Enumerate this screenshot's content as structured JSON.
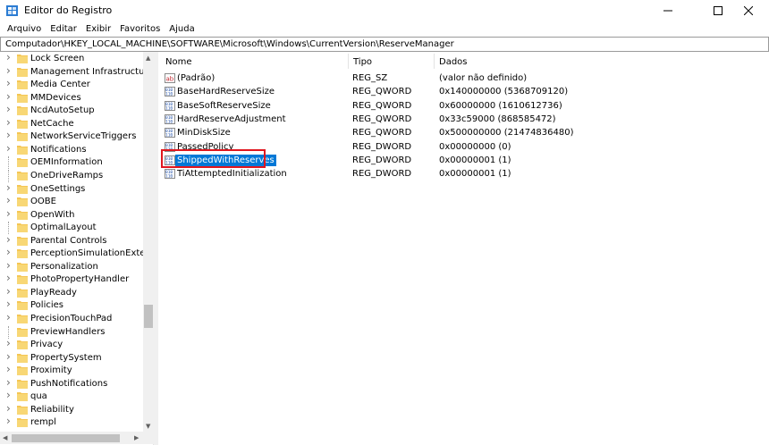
{
  "window": {
    "title": "Editor do Registro"
  },
  "menu": [
    "Arquivo",
    "Editar",
    "Exibir",
    "Favoritos",
    "Ajuda"
  ],
  "address": "Computador\\HKEY_LOCAL_MACHINE\\SOFTWARE\\Microsoft\\Windows\\CurrentVersion\\ReserveManager",
  "tree": [
    {
      "label": "Lock Screen",
      "chevron": true
    },
    {
      "label": "Management Infrastructure",
      "chevron": true
    },
    {
      "label": "Media Center",
      "chevron": true
    },
    {
      "label": "MMDevices",
      "chevron": true
    },
    {
      "label": "NcdAutoSetup",
      "chevron": true
    },
    {
      "label": "NetCache",
      "chevron": true
    },
    {
      "label": "NetworkServiceTriggers",
      "chevron": true
    },
    {
      "label": "Notifications",
      "chevron": true
    },
    {
      "label": "OEMInformation",
      "chevron": false
    },
    {
      "label": "OneDriveRamps",
      "chevron": false
    },
    {
      "label": "OneSettings",
      "chevron": true
    },
    {
      "label": "OOBE",
      "chevron": true
    },
    {
      "label": "OpenWith",
      "chevron": true
    },
    {
      "label": "OptimalLayout",
      "chevron": false
    },
    {
      "label": "Parental Controls",
      "chevron": true
    },
    {
      "label": "PerceptionSimulationExtensic",
      "chevron": true
    },
    {
      "label": "Personalization",
      "chevron": true
    },
    {
      "label": "PhotoPropertyHandler",
      "chevron": true
    },
    {
      "label": "PlayReady",
      "chevron": true
    },
    {
      "label": "Policies",
      "chevron": true
    },
    {
      "label": "PrecisionTouchPad",
      "chevron": true
    },
    {
      "label": "PreviewHandlers",
      "chevron": false
    },
    {
      "label": "Privacy",
      "chevron": true
    },
    {
      "label": "PropertySystem",
      "chevron": true
    },
    {
      "label": "Proximity",
      "chevron": true
    },
    {
      "label": "PushNotifications",
      "chevron": true
    },
    {
      "label": "qua",
      "chevron": true
    },
    {
      "label": "Reliability",
      "chevron": true
    },
    {
      "label": "rempl",
      "chevron": true
    }
  ],
  "columns": {
    "name": "Nome",
    "type": "Tipo",
    "data": "Dados"
  },
  "values": [
    {
      "name": "(Padrão)",
      "type": "REG_SZ",
      "data": "(valor não definido)",
      "icon": "string-value-icon"
    },
    {
      "name": "BaseHardReserveSize",
      "type": "REG_QWORD",
      "data": "0x140000000 (5368709120)",
      "icon": "binary-value-icon"
    },
    {
      "name": "BaseSoftReserveSize",
      "type": "REG_QWORD",
      "data": "0x60000000 (1610612736)",
      "icon": "binary-value-icon"
    },
    {
      "name": "HardReserveAdjustment",
      "type": "REG_QWORD",
      "data": "0x33c59000 (868585472)",
      "icon": "binary-value-icon"
    },
    {
      "name": "MinDiskSize",
      "type": "REG_QWORD",
      "data": "0x500000000 (21474836480)",
      "icon": "binary-value-icon"
    },
    {
      "name": "PassedPolicy",
      "type": "REG_DWORD",
      "data": "0x00000000 (0)",
      "icon": "binary-value-icon"
    },
    {
      "name": "ShippedWithReserves",
      "type": "REG_DWORD",
      "data": "0x00000001 (1)",
      "icon": "binary-value-icon",
      "selected": true
    },
    {
      "name": "TiAttemptedInitialization",
      "type": "REG_DWORD",
      "data": "0x00000001 (1)",
      "icon": "binary-value-icon"
    }
  ],
  "colors": {
    "selection": "#0078d7",
    "highlight_border": "#e0161e",
    "folder": "#f5c654"
  }
}
